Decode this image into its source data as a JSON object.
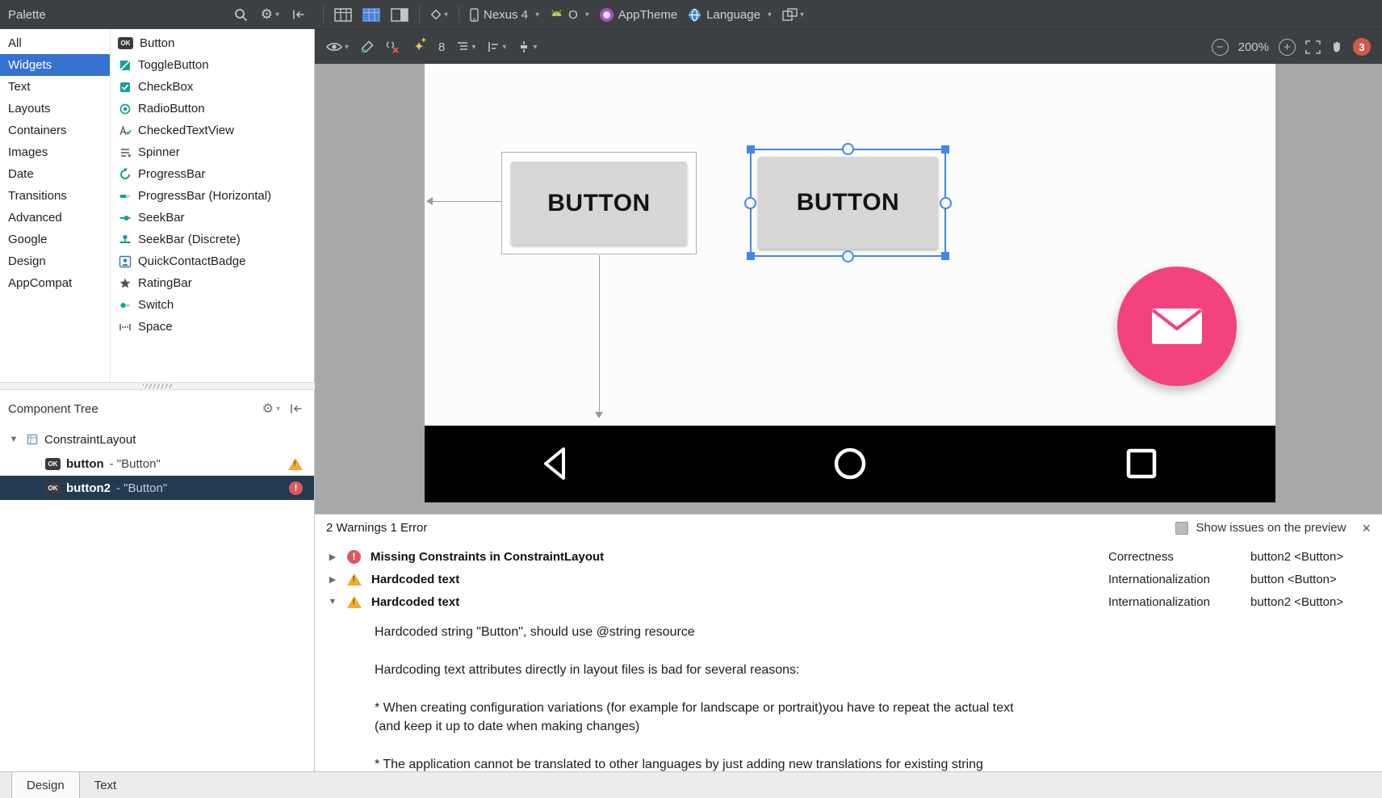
{
  "icons": {
    "gear": "⚙",
    "dropdown": "▾",
    "tree_expanded": "▼",
    "row_collapsed": "▶",
    "row_expanded": "▼",
    "minus": "−",
    "plus": "+",
    "close": "×",
    "sparkle": "✦",
    "ok": "OK"
  },
  "colors": {
    "toolbar_bg": "#3d4042",
    "selection_blue": "#3672cf",
    "tree_selected_bg": "#233a50",
    "widget_teal": "#12a093",
    "surface_gray": "#a6a8aa",
    "handle_blue": "#4285f4",
    "fab_pink": "#f4417f",
    "warning_yellow": "#f3ac33",
    "error_red": "#db5860"
  },
  "top_toolbar": {
    "palette_label": "Palette",
    "device": "Nexus 4",
    "api_level": "O",
    "theme": "AppTheme",
    "language": "Language"
  },
  "design_toolbar": {
    "default_margin": "8",
    "zoom_level": "200%",
    "error_count": "3"
  },
  "palette": {
    "categories": [
      "All",
      "Widgets",
      "Text",
      "Layouts",
      "Containers",
      "Images",
      "Date",
      "Transitions",
      "Advanced",
      "Google",
      "Design",
      "AppCompat"
    ],
    "widgets": [
      "Button",
      "ToggleButton",
      "CheckBox",
      "RadioButton",
      "CheckedTextView",
      "Spinner",
      "ProgressBar",
      "ProgressBar (Horizontal)",
      "SeekBar",
      "SeekBar (Discrete)",
      "QuickContactBadge",
      "RatingBar",
      "Switch",
      "Space"
    ]
  },
  "component_tree": {
    "title": "Component Tree",
    "root": "ConstraintLayout",
    "item1_id": "button",
    "item1_suffix": "- \"Button\"",
    "item2_id": "button2",
    "item2_suffix": "- \"Button\""
  },
  "canvas": {
    "button1_label": "BUTTON",
    "button2_label": "BUTTON"
  },
  "issues": {
    "summary": "2 Warnings 1 Error",
    "show_issues_label": "Show issues on the preview",
    "rows": [
      {
        "title": "Missing Constraints in ConstraintLayout",
        "category": "Correctness",
        "component": "button2 <Button>"
      },
      {
        "title": "Hardcoded text",
        "category": "Internationalization",
        "component": "button <Button>"
      },
      {
        "title": "Hardcoded text",
        "category": "Internationalization",
        "component": "button2 <Button>"
      }
    ],
    "detail": {
      "para1": "Hardcoded string \"Button\", should use @string resource",
      "para2": "Hardcoding text attributes directly in layout files is bad for several reasons:",
      "para3a": "* When creating configuration variations (for example for landscape or portrait)you have to repeat the actual text",
      "para3b": "(and keep it up to date when making changes)",
      "para4": "* The application cannot be translated to other languages by just adding new translations for existing string"
    }
  },
  "bottom_bar": {
    "tabs": [
      "Design",
      "Text"
    ]
  }
}
